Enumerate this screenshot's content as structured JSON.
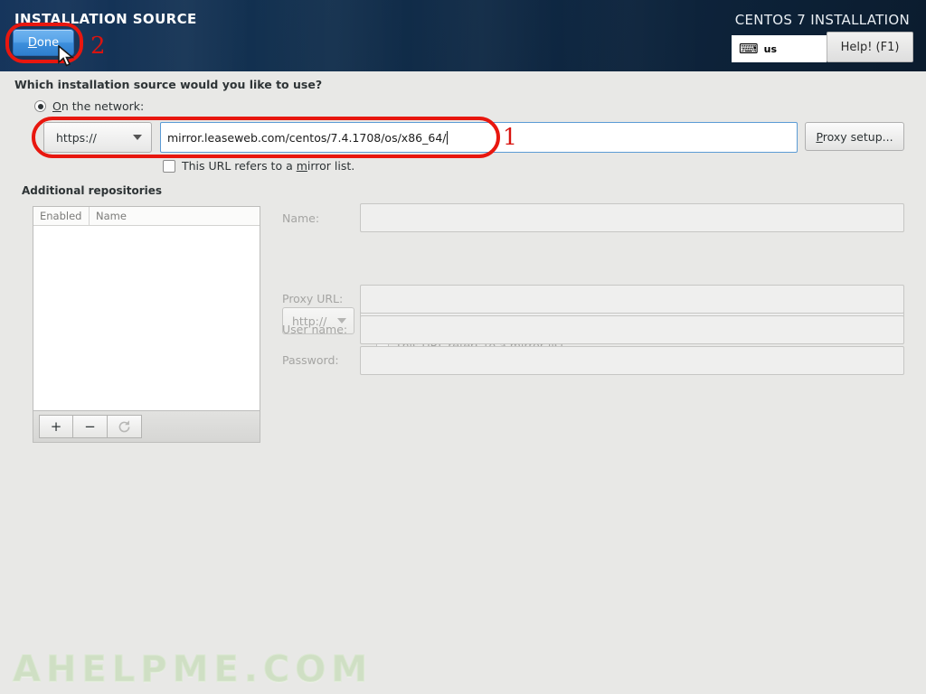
{
  "header": {
    "title": "INSTALLATION SOURCE",
    "product_title": "CENTOS 7 INSTALLATION",
    "done_label": "Done",
    "help_label": "Help! (F1)",
    "keyboard_icon": "keyboard-icon",
    "keyboard_layout": "us",
    "marker_done": "2"
  },
  "main": {
    "question": "Which installation source would you like to use?",
    "network_radio_label": "On the network:",
    "protocol_selected": "https://",
    "url_value": "mirror.leaseweb.com/centos/7.4.1708/os/x86_64/",
    "proxy_setup_label": "Proxy setup...",
    "mirror_list_label": "This URL refers to a mirror list.",
    "marker_url": "1"
  },
  "additional_repositories": {
    "section_label": "Additional repositories",
    "columns": [
      "Enabled",
      "Name"
    ],
    "rows": [],
    "toolbar": {
      "add_label": "+",
      "remove_label": "−",
      "reset_icon": "refresh-icon"
    },
    "details": {
      "name_label": "Name:",
      "name_value": "",
      "protocol_selected": "http://",
      "repo_url_value": "",
      "mirror_list_label": "This URL refers to a mirror list.",
      "proxy_url_label": "Proxy URL:",
      "proxy_url_value": "",
      "user_name_label": "User name:",
      "user_name_value": "",
      "password_label": "Password:",
      "password_value": ""
    }
  },
  "watermark": {
    "text": "AHELPME.COM"
  },
  "colors": {
    "header_dark": "#0e2640",
    "accent_blue": "#5b9bd5",
    "annotation_red": "#e8170f",
    "done_blue": "#3d8fdc",
    "watermark_green": "#cfdfc4"
  }
}
